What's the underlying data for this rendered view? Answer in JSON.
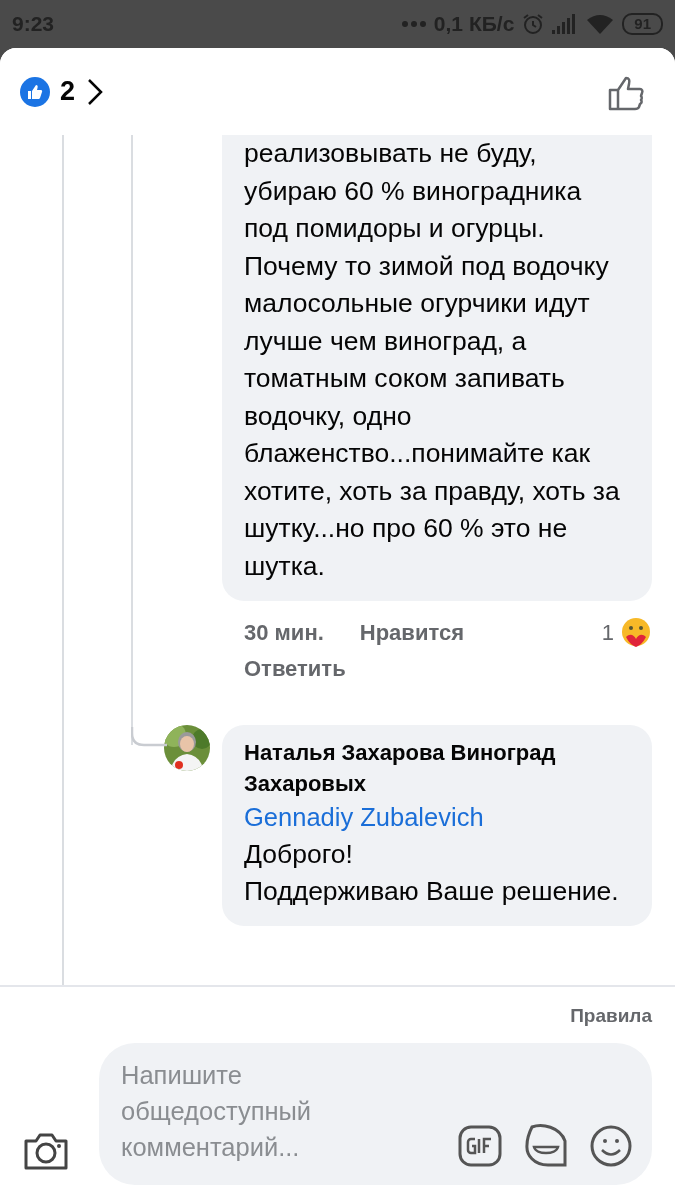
{
  "status_bar": {
    "time": "9:23",
    "speed": "0,1 КБ/с",
    "battery": "91"
  },
  "header": {
    "like_count": "2"
  },
  "comment": {
    "text": "реализовывать не буду, убираю 60 % виноградника под помидоры и огурцы. Почему то зимой под водочку малосольные огурчики идут лучше чем виноград, а томатным соком запивать водочку, одно блаженство...понимайте как хотите, хоть за правду, хоть за шутку...но про 60 % это не шутка.",
    "time": "30 мин.",
    "like_action": "Нравится",
    "reaction_count": "1",
    "reply_action": "Ответить"
  },
  "reply": {
    "author": "Наталья Захарова Виноград Захаровых",
    "mention": "Gennadiy Zubalevich",
    "lines": [
      "Доброго!",
      "Поддерживаю Ваше решение."
    ]
  },
  "footer": {
    "rules": "Правила",
    "placeholder": "Напишите общедоступный комментарий..."
  }
}
